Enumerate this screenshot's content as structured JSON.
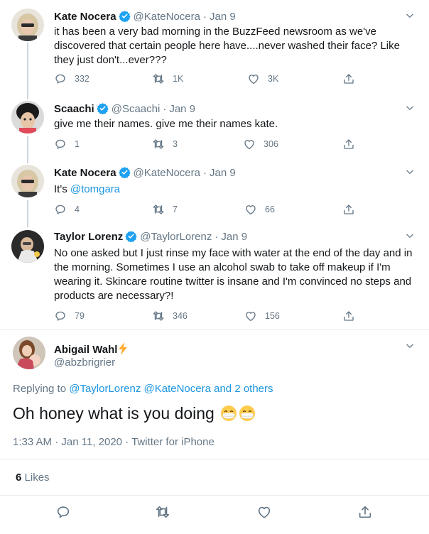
{
  "colors": {
    "accent": "#1b95e0",
    "muted": "#657786",
    "text": "#14171a",
    "divider": "#e6ecf0",
    "lightning": "#ffac33"
  },
  "tweets": [
    {
      "name": "Kate Nocera",
      "handle": "@KateNocera",
      "date": "Jan 9",
      "text": "it has been a very bad morning in the BuzzFeed newsroom as we've discovered that certain people here have....never washed their face? Like they just don't...ever???",
      "replies": "332",
      "retweets": "1K",
      "likes": "3K"
    },
    {
      "name": "Scaachi",
      "handle": "@Scaachi",
      "date": "Jan 9",
      "text": "give me their names. give me their names kate.",
      "replies": "1",
      "retweets": "3",
      "likes": "306"
    },
    {
      "name": "Kate Nocera",
      "handle": "@KateNocera",
      "date": "Jan 9",
      "text_prefix": "It's ",
      "mention": "@tomgara",
      "replies": "4",
      "retweets": "7",
      "likes": "66"
    },
    {
      "name": "Taylor Lorenz",
      "handle": "@TaylorLorenz",
      "date": "Jan 9",
      "text": "No one asked but I just rinse my face with water at the end of the day and in the morning. Sometimes I use an alcohol swab to take off makeup if I'm wearing it. Skincare routine twitter is insane and I'm convinced no steps and products are necessary?!",
      "replies": "79",
      "retweets": "346",
      "likes": "156"
    }
  ],
  "main": {
    "name": "Abigail Wahl",
    "handle": "@abzbrigrier",
    "replying_label": "Replying to",
    "replying_to": [
      "@TaylorLorenz",
      "@KateNocera"
    ],
    "replying_others": "and 2 others",
    "text": "Oh honey what is you doing",
    "emoji": "mask-face-emoji",
    "time": "1:33 AM",
    "date": "Jan 11, 2020",
    "source": "Twitter for iPhone",
    "likes_count": "6",
    "likes_label": "Likes"
  }
}
